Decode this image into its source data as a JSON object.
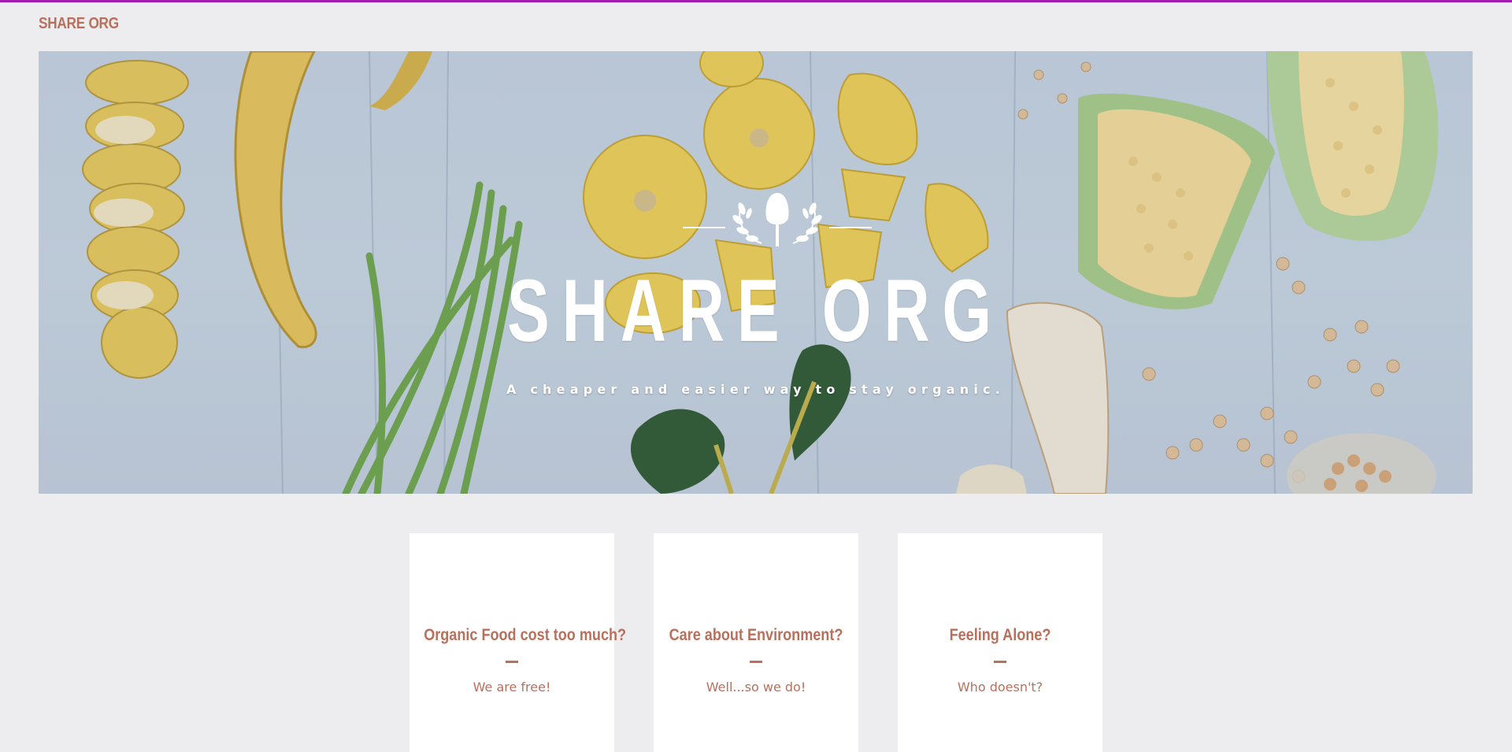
{
  "site": {
    "logo_text": "SHARE ORG",
    "accent_color": "#b8705d",
    "top_border_color": "#a21caf"
  },
  "hero": {
    "emblem_icon": "spade-with-laurels-icon",
    "title": "SHARE ORG",
    "tagline": "A cheaper and easier way to stay organic.",
    "background": "photo of vegetables: bananas, yellow squash, corn, parsnips, beans on blue wooden table"
  },
  "features": [
    {
      "title": "Organic Food cost too much?",
      "text": "We are free!"
    },
    {
      "title": "Care about Environment?",
      "text": "Well...so we do!"
    },
    {
      "title": "Feeling Alone?",
      "text": "Who doesn't?"
    }
  ]
}
